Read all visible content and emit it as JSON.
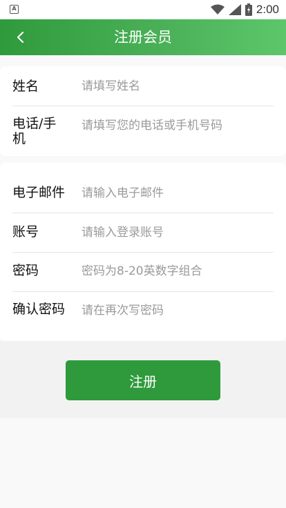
{
  "status_bar": {
    "app_icon_letter": "A",
    "time": "2:00",
    "icons": [
      "wifi-icon",
      "signal-icon",
      "battery-icon"
    ]
  },
  "app_bar": {
    "title": "注册会员",
    "back_icon": "chevron-left-icon",
    "color_start": "#2f9a3b",
    "color_end": "#5dc66a"
  },
  "form": {
    "section1": [
      {
        "label": "姓名",
        "placeholder": "请填写姓名"
      },
      {
        "label": "电话/手机",
        "placeholder": "请填写您的电话或手机号码"
      }
    ],
    "section2": [
      {
        "label": "电子邮件",
        "placeholder": "请输入电子邮件"
      },
      {
        "label": "账号",
        "placeholder": "请输入登录账号"
      },
      {
        "label": "密码",
        "placeholder": "密码为8-20英数字组合"
      },
      {
        "label": "确认密码",
        "placeholder": "请在再次写密码"
      }
    ]
  },
  "register_button": {
    "label": "注册",
    "color": "#2f9a3b"
  }
}
